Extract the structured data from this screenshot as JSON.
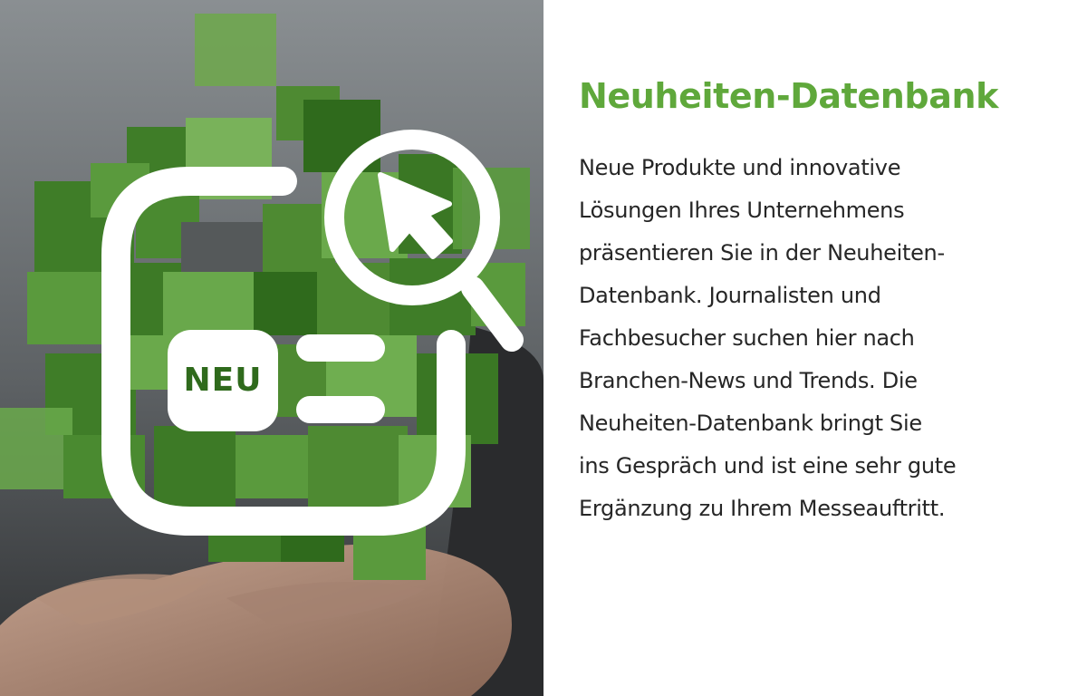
{
  "colors": {
    "accent_green": "#5fa83b",
    "text_dark": "#262626",
    "icon_white": "#ffffff"
  },
  "hero": {
    "icon": "news-database-search-icon",
    "badge_label": "NEU"
  },
  "heading": "Neuheiten-Datenbank",
  "body_lines": [
    "Neue Produkte und innovative",
    "Lösungen Ihres Unternehmens",
    "präsentieren Sie in der Neuheiten-",
    "Datenbank. Journalisten und",
    "Fachbesucher suchen hier nach",
    "Branchen-News und Trends. Die",
    "Neuheiten-Datenbank bringt Sie",
    "ins Gespräch und ist eine sehr gute",
    "Ergänzung zu Ihrem Messeauftritt."
  ]
}
